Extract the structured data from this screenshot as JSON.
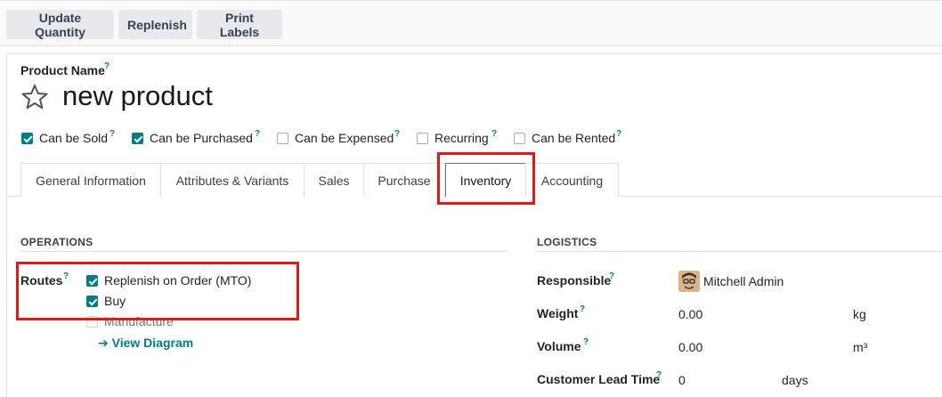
{
  "toolbar": {
    "update_quantity": "Update Quantity",
    "replenish": "Replenish",
    "print_labels": "Print Labels"
  },
  "product": {
    "name_label": "Product Name",
    "help": "?",
    "name": "new product"
  },
  "options": [
    {
      "label": "Can be Sold",
      "checked": true
    },
    {
      "label": "Can be Purchased",
      "checked": true
    },
    {
      "label": "Can be Expensed",
      "checked": false
    },
    {
      "label": "Recurring",
      "checked": false
    },
    {
      "label": "Can be Rented",
      "checked": false
    }
  ],
  "tabs": [
    {
      "label": "General Information",
      "active": false
    },
    {
      "label": "Attributes & Variants",
      "active": false
    },
    {
      "label": "Sales",
      "active": false
    },
    {
      "label": "Purchase",
      "active": false
    },
    {
      "label": "Inventory",
      "active": true
    },
    {
      "label": "Accounting",
      "active": false
    }
  ],
  "operations": {
    "title": "OPERATIONS",
    "routes_label": "Routes",
    "routes": [
      {
        "label": "Replenish on Order (MTO)",
        "checked": true
      },
      {
        "label": "Buy",
        "checked": true
      },
      {
        "label": "Manufacture",
        "checked": false
      }
    ],
    "view_diagram": "View Diagram"
  },
  "logistics": {
    "title": "LOGISTICS",
    "responsible_label": "Responsible",
    "responsible": "Mitchell Admin",
    "weight_label": "Weight",
    "weight": "0.00",
    "weight_unit": "kg",
    "volume_label": "Volume",
    "volume": "0.00",
    "volume_unit": "m³",
    "lead_time_label": "Customer Lead Time",
    "lead_time": "0",
    "lead_time_unit": "days"
  },
  "colors": {
    "accent": "#017e84",
    "highlight": "#e01818"
  }
}
